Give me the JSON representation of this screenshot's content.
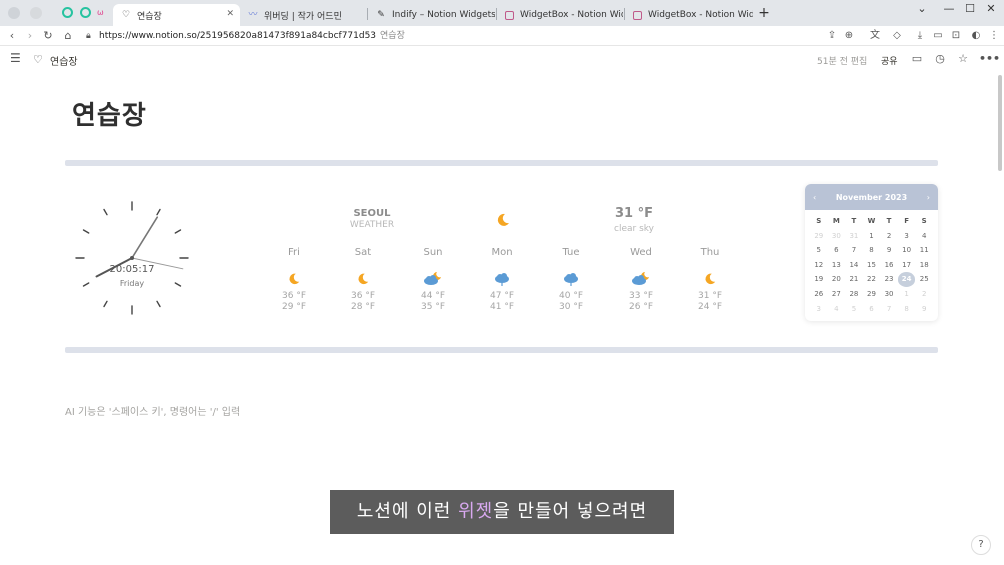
{
  "browser": {
    "tabs": [
      {
        "label": "연습장",
        "active": true,
        "favicon": "heart-icon"
      },
      {
        "label": "위버딩 | 작가 어드민",
        "active": false,
        "favicon": "wave-icon"
      },
      {
        "label": "Indify – Notion Widgets",
        "active": false,
        "favicon": "feather-icon"
      },
      {
        "label": "WidgetBox - Notion Widgets",
        "active": false,
        "favicon": "widgetbox-icon"
      },
      {
        "label": "WidgetBox - Notion Widgets",
        "active": false,
        "favicon": "widgetbox-icon"
      }
    ],
    "url": "https://www.notion.so/251956820a81473f891a84cbcf771d53",
    "url_page_title": "연습장"
  },
  "notion": {
    "page_name": "연습장",
    "edited": "51분 전 편집",
    "share": "공유"
  },
  "page": {
    "title": "연습장",
    "hint": "AI 기능은 '스페이스 키', 명령어는 '/' 입력"
  },
  "clock": {
    "time": "20:05:17",
    "day": "Friday",
    "hour": 20,
    "minute": 5,
    "second": 17
  },
  "weather": {
    "city": "SEOUL",
    "label": "WEATHER",
    "temp": "31 °F",
    "desc": "clear sky",
    "now_icon": "moon-icon",
    "forecast": [
      {
        "day": "Fri",
        "icon": "moon-icon",
        "hi": "36 °F",
        "lo": "29 °F"
      },
      {
        "day": "Sat",
        "icon": "moon-icon",
        "hi": "36 °F",
        "lo": "28 °F"
      },
      {
        "day": "Sun",
        "icon": "cloud-moon-icon",
        "hi": "44 °F",
        "lo": "35 °F"
      },
      {
        "day": "Mon",
        "icon": "rain-cloud-icon",
        "hi": "47 °F",
        "lo": "41 °F"
      },
      {
        "day": "Tue",
        "icon": "rain-cloud-icon",
        "hi": "40 °F",
        "lo": "30 °F"
      },
      {
        "day": "Wed",
        "icon": "cloud-moon-icon",
        "hi": "33 °F",
        "lo": "26 °F"
      },
      {
        "day": "Thu",
        "icon": "moon-icon",
        "hi": "31 °F",
        "lo": "24 °F"
      }
    ]
  },
  "calendar": {
    "month": "November 2023",
    "prev": "‹",
    "next": "›",
    "weekdays": [
      "S",
      "M",
      "T",
      "W",
      "T",
      "F",
      "S"
    ],
    "days": [
      {
        "d": "29",
        "dim": true
      },
      {
        "d": "30",
        "dim": true
      },
      {
        "d": "31",
        "dim": true
      },
      {
        "d": "1"
      },
      {
        "d": "2"
      },
      {
        "d": "3"
      },
      {
        "d": "4"
      },
      {
        "d": "5"
      },
      {
        "d": "6"
      },
      {
        "d": "7"
      },
      {
        "d": "8"
      },
      {
        "d": "9"
      },
      {
        "d": "10"
      },
      {
        "d": "11"
      },
      {
        "d": "12"
      },
      {
        "d": "13"
      },
      {
        "d": "14"
      },
      {
        "d": "15"
      },
      {
        "d": "16"
      },
      {
        "d": "17"
      },
      {
        "d": "18"
      },
      {
        "d": "19"
      },
      {
        "d": "20"
      },
      {
        "d": "21"
      },
      {
        "d": "22"
      },
      {
        "d": "23"
      },
      {
        "d": "24",
        "today": true
      },
      {
        "d": "25"
      },
      {
        "d": "26"
      },
      {
        "d": "27"
      },
      {
        "d": "28"
      },
      {
        "d": "29"
      },
      {
        "d": "30"
      },
      {
        "d": "1",
        "dim": true
      },
      {
        "d": "2",
        "dim": true
      },
      {
        "d": "3",
        "dim": true
      },
      {
        "d": "4",
        "dim": true
      },
      {
        "d": "5",
        "dim": true
      },
      {
        "d": "6",
        "dim": true
      },
      {
        "d": "7",
        "dim": true
      },
      {
        "d": "8",
        "dim": true
      },
      {
        "d": "9",
        "dim": true
      }
    ]
  },
  "subtitle": {
    "before": "노션에 이런 ",
    "highlight": "위젯",
    "after": "을 만들어 넣으려면"
  },
  "help": "?",
  "colors": {
    "accent": "#b9c3d6",
    "divider": "#dde1ea",
    "moon": "#f5a623",
    "cloud": "#5b9bd5"
  }
}
